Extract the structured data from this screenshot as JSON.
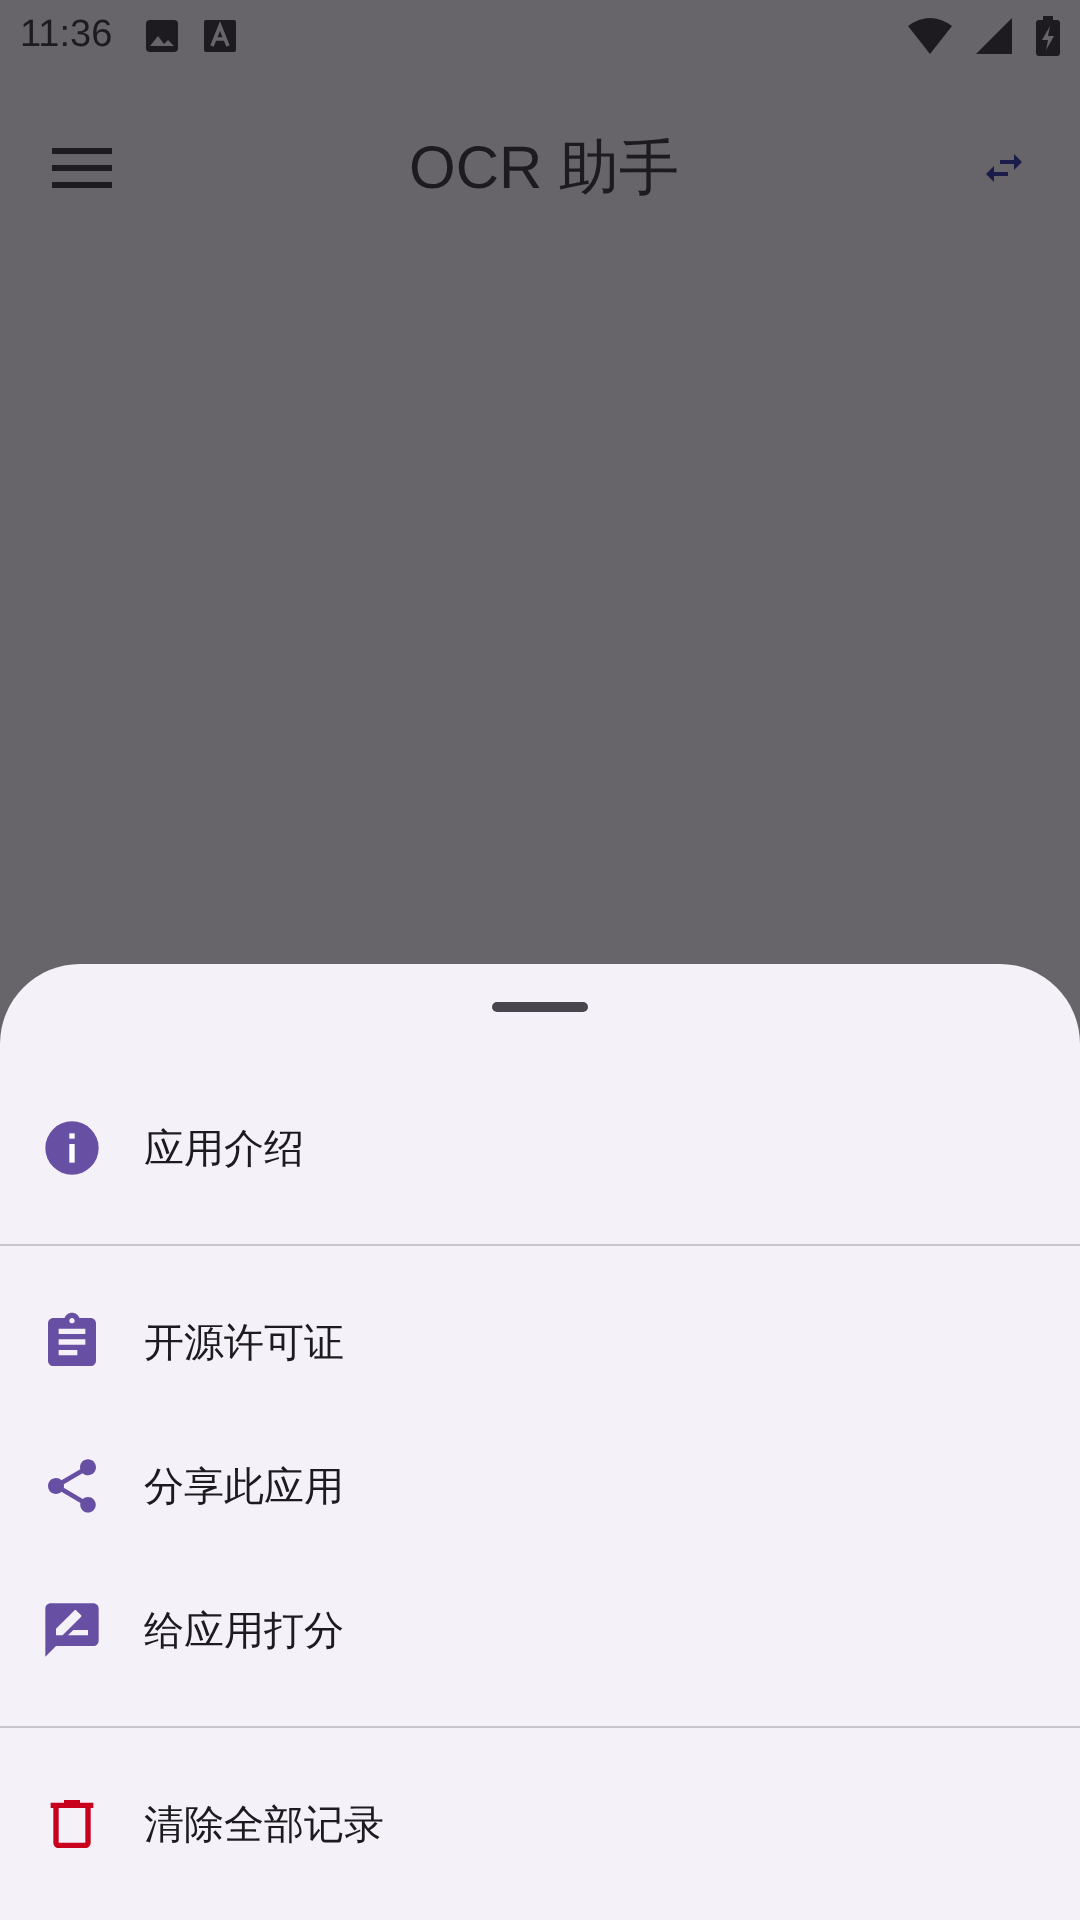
{
  "status_bar": {
    "time": "11:36"
  },
  "app_bar": {
    "title": "OCR 助手"
  },
  "sheet": {
    "groups": [
      [
        {
          "kind": "info",
          "label": "应用介绍"
        }
      ],
      [
        {
          "kind": "license",
          "label": "开源许可证"
        },
        {
          "kind": "share",
          "label": "分享此应用"
        },
        {
          "kind": "rate",
          "label": "给应用打分"
        }
      ],
      [
        {
          "kind": "delete",
          "label": "清除全部记录"
        }
      ]
    ]
  }
}
